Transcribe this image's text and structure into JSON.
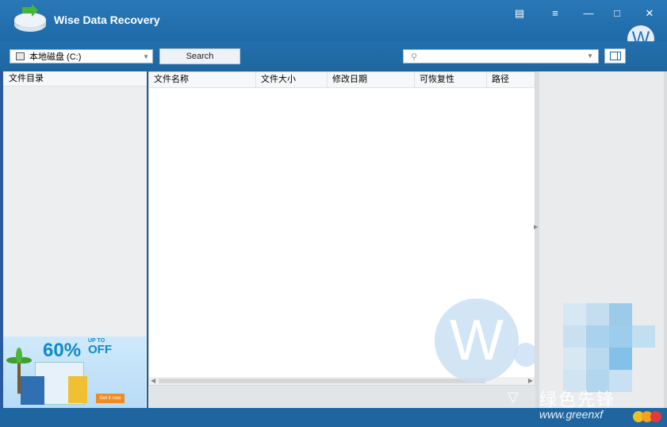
{
  "window": {
    "title": "Wise Data Recovery",
    "controls": [
      "feedback-icon",
      "menu-icon",
      "minimize-icon",
      "maximize-icon",
      "close-icon"
    ],
    "avatar_letter": "W"
  },
  "toolbar": {
    "drive_select": "本地磁盘 (C:)",
    "search_label": "Search",
    "filter_placeholder": ""
  },
  "left_panel": {
    "header": "文件目录"
  },
  "file_table": {
    "columns": [
      "文件名称",
      "文件大小",
      "修改日期",
      "可恢复性",
      "路径"
    ],
    "rows": []
  },
  "ad": {
    "upto": "UP TO",
    "percent": "60%",
    "off": "OFF",
    "cta": "Get it now"
  },
  "watermark": {
    "letter": "W",
    "brand": "绿色先锋",
    "url": "www.greenxf"
  },
  "colors": {
    "titlebar": "#2a78b7",
    "accent": "#1e66a0",
    "panel": "#eceef0"
  }
}
